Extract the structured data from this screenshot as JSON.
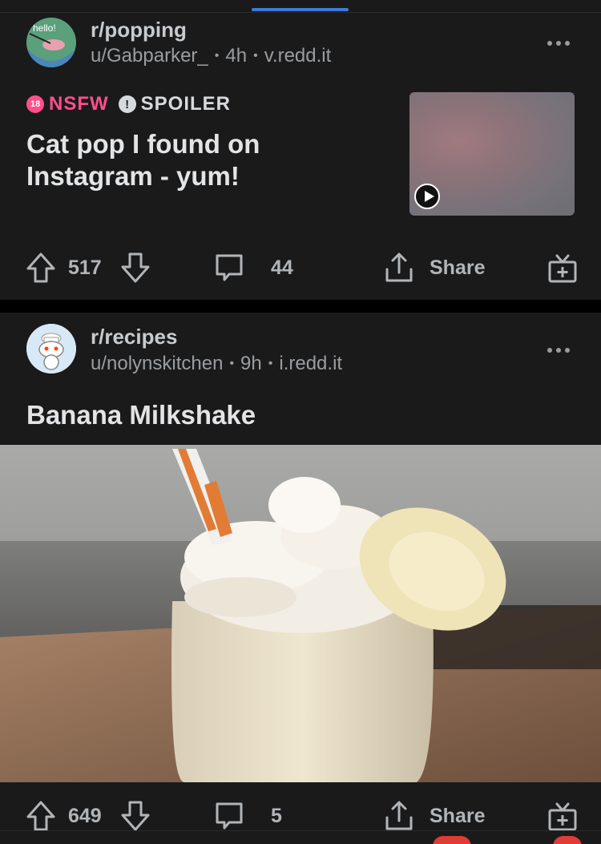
{
  "posts": [
    {
      "subreddit": "r/popping",
      "author": "u/Gabparker_",
      "time": "4h",
      "domain": "v.redd.it",
      "flairs": {
        "nsfw_badge": "18",
        "nsfw_label": "NSFW",
        "spoiler_badge": "!",
        "spoiler_label": "SPOILER"
      },
      "avatar_text": "hello!",
      "title": "Cat pop I found on Instagram - yum!",
      "media": "video-thumbnail",
      "score": "517",
      "comments": "44",
      "share_label": "Share"
    },
    {
      "subreddit": "r/recipes",
      "author": "u/nolynskitchen",
      "time": "9h",
      "domain": "i.redd.it",
      "title": "Banana Milkshake",
      "media": "photo-banana-milkshake",
      "score": "649",
      "comments": "5",
      "share_label": "Share"
    }
  ],
  "icons": [
    "more-icon",
    "upvote-icon",
    "downvote-icon",
    "comment-icon",
    "share-icon",
    "award-icon",
    "play-icon",
    "nsfw-icon",
    "spoiler-icon"
  ],
  "colors": {
    "background": "#1a1a1b",
    "accent": "#3f7bd6",
    "nsfw": "#ff4f8b",
    "text_muted": "#9a9da0",
    "notification": "#e03b35"
  }
}
